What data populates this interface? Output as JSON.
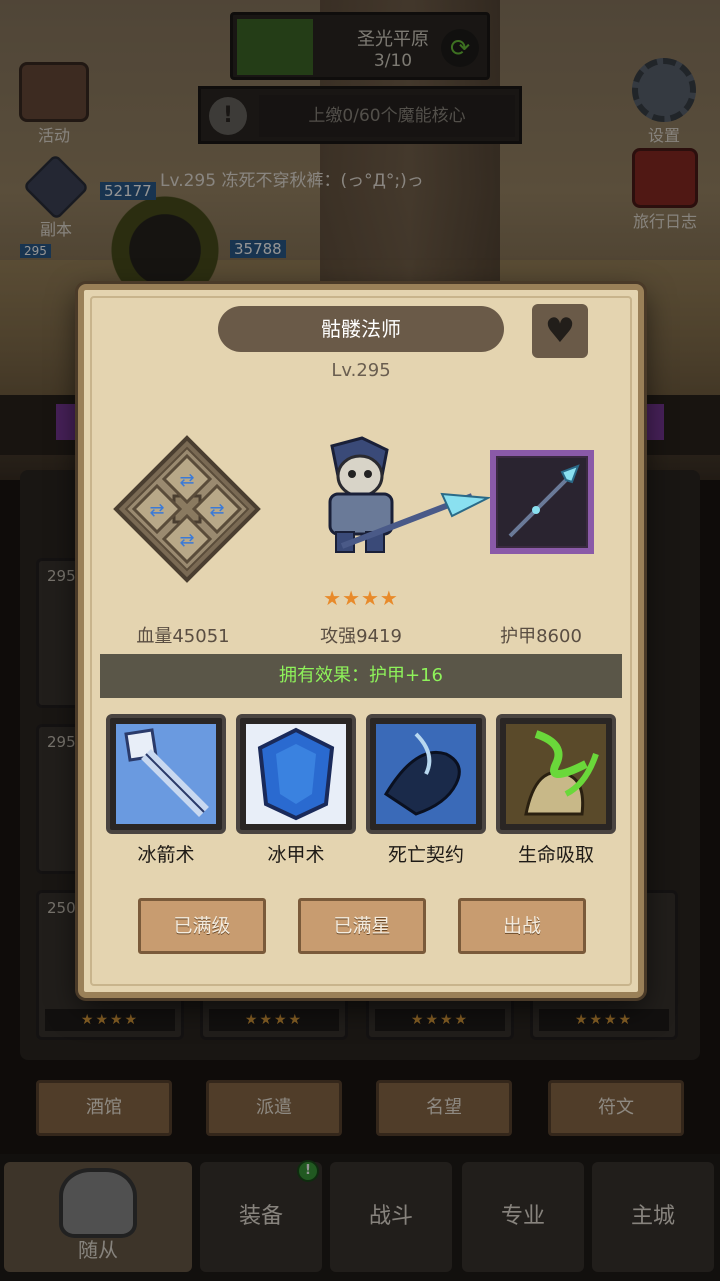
{
  "stage": {
    "name": "圣光平原",
    "progress_text": "3/10",
    "progress_fraction": 0.3,
    "refresh_icon": "refresh-icon"
  },
  "quest": {
    "text": "上缴0/60个魔能核心",
    "icon": "alert-icon"
  },
  "side_buttons": {
    "activity": "活动",
    "dungeon": "副本",
    "settings": "设置",
    "journal": "旅行日志"
  },
  "chat": {
    "line": "Lv.295 冻死不穿秋裤：(っ°Д°;)っ"
  },
  "hp_tags": {
    "a": "52177",
    "b": "35788",
    "c": "295"
  },
  "hero_cards": [
    {
      "lv": "295",
      "stars": "★★★★"
    },
    {
      "lv": "295",
      "stars": "★★★★"
    },
    {
      "lv": "250",
      "stars": "★★★★"
    },
    {
      "lv": "",
      "stars": "★★★★"
    },
    {
      "lv": "",
      "stars": "★★★★"
    },
    {
      "lv": "",
      "stars": "★★★★"
    }
  ],
  "mid_buttons": [
    "酒馆",
    "派遣",
    "名望",
    "符文"
  ],
  "nav": {
    "followers": "随从",
    "equipment": "装备",
    "battle": "战斗",
    "profession": "专业",
    "main_city": "主城",
    "badge": "!"
  },
  "modal": {
    "title": "骷髅法师",
    "level": "Lv.295",
    "stars": "★★★★",
    "star_count": 4,
    "stats": {
      "hp": "血量45051",
      "attack": "攻强9419",
      "armor": "护甲8600"
    },
    "effect": "拥有效果：护甲+16",
    "skills": [
      {
        "name": "冰箭术",
        "icon": "ice-arrow-icon"
      },
      {
        "name": "冰甲术",
        "icon": "ice-armor-icon"
      },
      {
        "name": "死亡契约",
        "icon": "death-pact-icon"
      },
      {
        "name": "生命吸取",
        "icon": "life-drain-icon"
      }
    ],
    "buttons": {
      "max_level": "已满级",
      "max_star": "已满星",
      "deploy": "出战"
    }
  },
  "colors": {
    "effect_text": "#8ef25a",
    "star": "#e88a2a",
    "weapon_frame": "#8a5aa8"
  }
}
